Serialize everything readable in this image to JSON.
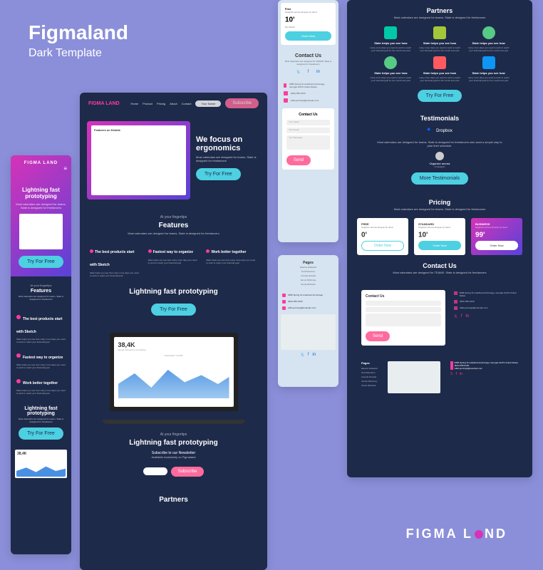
{
  "title": "Figmaland",
  "subtitle": "Dark Template",
  "brand": "FIGMA LAND",
  "mobile": {
    "hero_title": "Lightning fast prototyping",
    "hero_sub": "Most calendars are designed for teams. Slate is designed for freelancers",
    "cta": "Try For Free",
    "features_sub": "At your fingertips",
    "features_title": "Features",
    "features_desc": "Most calendars are designed for teams. Slate is designed for freelancers",
    "f1_title": "The best products start with Sketch",
    "f1_desc": "Slate helps you see how many more days you need to work to reach your financial goal",
    "f2_title": "Fastest way to organize",
    "f2_desc": "Slate helps you see how many more days you need to work to reach your financial goal",
    "f3_title": "Work better together",
    "f3_desc": "Slate helps you see how many more days you need to work to reach your financial goal",
    "proto_title": "Lightning fast prototyping",
    "proto_sub": "Most calendars are designed for teams. Slate is designed for freelancers"
  },
  "desktop": {
    "nav": {
      "home": "Home",
      "product": "Product",
      "pricing": "Pricing",
      "about": "About",
      "contact": "Contact",
      "your_name": "Your Name",
      "subscribe": "Subscribe"
    },
    "hero_title": "We focus on ergonomics",
    "hero_sub": "Most calendars are designed for teams. Slate is designed for freelancers",
    "cta": "Try For Free",
    "features_sub": "At your fingertips",
    "features_title": "Features",
    "features_desc": "Most calendars are designed for teams. Slate is designed for freelancers",
    "dash_title": "Features on Details",
    "f1_title": "The best products start with Sketch",
    "f1_desc": "Slate helps you see how many more days you need to work to reach your financial goal",
    "f2_title": "Fastest way to organize",
    "f2_desc": "Slate helps you see how many more days you need to work to reach your financial goal",
    "f3_title": "Work better together",
    "f3_desc": "Slate helps you see how many more days you need to work to reach your financial goal",
    "proto_title": "Lightning fast prototyping",
    "stat_value": "38,4K",
    "stat_label": "Spend reduced by something",
    "chart_label": "Downloads: 10,345",
    "newsletter_sub": "At your fingertips",
    "newsletter_title": "Lightning fast prototyping",
    "newsletter_h": "Subscribe to our Newsletter",
    "newsletter_p": "Available exclusively on Figmaland",
    "partners_title": "Partners"
  },
  "contact_light": {
    "price_label": "Free",
    "price_desc": "Organize across all apps by hand",
    "price_value": "10",
    "price_unit": "$",
    "price_period": "Per Month",
    "order": "Order Now",
    "title": "Contact Us",
    "sub": "Most calendars are designed for TEAMS. Slate is designed for freelancers",
    "addr": "6386 Spring St undefined Anchorage, Georgia 12473 United States",
    "phone": "(843) 555-0130",
    "email": "willie.jennings@example.com",
    "form_title": "Contact Us",
    "form_name": "Your Name",
    "form_email": "Your Email",
    "form_msg": "Your Message",
    "send": "Send"
  },
  "pages_light": {
    "title": "Pages",
    "links": [
      "Eleanor Edwards",
      "Ted Robertson",
      "Annette Russell",
      "Jennie Mckinney",
      "Gloria Richards"
    ],
    "addr": "6386 Spring St undefined Anchorage",
    "phone": "(843) 555-0130",
    "email": "willie.jennings@example.com"
  },
  "dark_right": {
    "partners_title": "Partners",
    "partners_sub": "Most calendars are designed for teams. Slate is designed for freelancers",
    "p_title": "Slate helps you see how",
    "p_desc": "many more days you need to work to reach your financial goal for the month and year",
    "cta": "Try For Free",
    "testimonials_title": "Testimonials",
    "dropbox": "Dropbox",
    "testi_text": "Most calendars are designed for teams. Slate is designed for freelancers who want a simple way to plan their schedule.",
    "testi_name": "Organize across",
    "testi_role": "UI designer",
    "more": "More Testimonials",
    "pricing_title": "Pricing",
    "pricing_sub": "Most calendars are designed for teams. Slate is designed for freelancers",
    "plans": [
      {
        "name": "FREE",
        "desc": "Organize across all apps by hand",
        "price": "0",
        "unit": "$",
        "period": "Per Month",
        "btn": "Order Now"
      },
      {
        "name": "STANDARD",
        "desc": "Organize across all apps by hand",
        "price": "10",
        "unit": "$",
        "period": "Per Month",
        "btn": "Order Now"
      },
      {
        "name": "BUSINESS",
        "desc": "Organize across all apps by hand",
        "price": "99",
        "unit": "$",
        "period": "Per Month",
        "btn": "Order Now"
      }
    ],
    "contact_title": "Contact Us",
    "contact_sub": "Most calendars are designed for TEAMS. Slate is designed for freelancers",
    "form_title": "Contact Us",
    "send": "Send",
    "addr": "6386 Spring St undefined Anchorage, Georgia 12473 United States",
    "phone": "(843) 555-0130",
    "email": "willie.jennings@example.com",
    "footer_pages": "Pages",
    "footer_links": [
      "Eleanor Edwards",
      "Ted Robertson",
      "Annette Russell",
      "Jennie Mckinney",
      "Gloria Richards"
    ]
  },
  "footer_brand": "FIGMA LAND",
  "colors": {
    "accent": "#ff3b9d",
    "cyan": "#4dd0e1",
    "dark": "#1e2a4a"
  }
}
